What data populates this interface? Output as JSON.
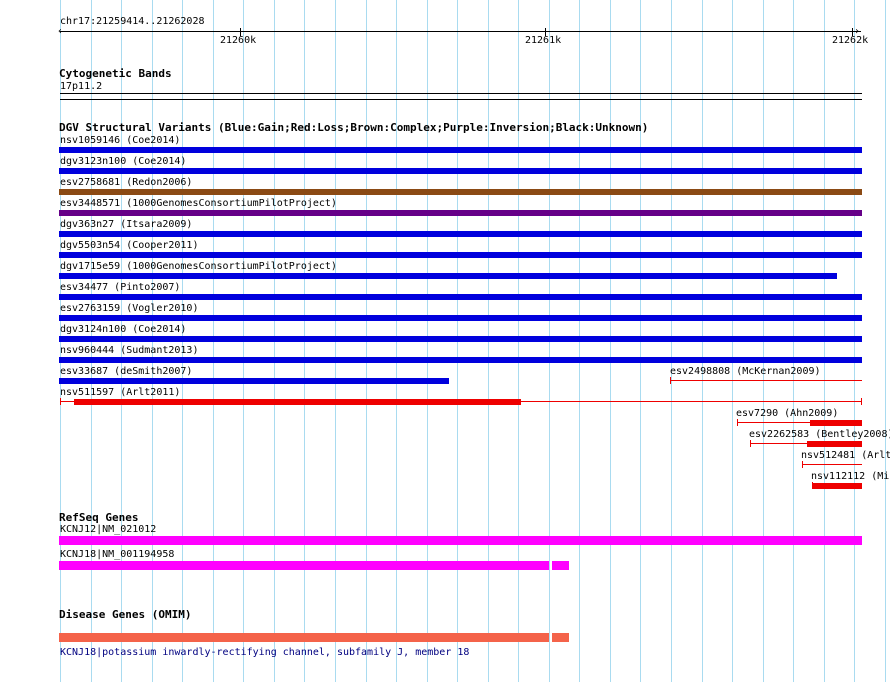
{
  "ruler": {
    "location": "chr17:21259414..21262028",
    "ticks": [
      "21260k",
      "21261k",
      "21262k"
    ]
  },
  "cytoband": {
    "title": "Cytogenetic Bands",
    "band": "17p11.2"
  },
  "dgv": {
    "title": "DGV Structural Variants (Blue:Gain;Red:Loss;Brown:Complex;Purple:Inversion;Black:Unknown)",
    "colors": {
      "gain": "#0000dd",
      "loss": "#ee0000",
      "complex": "#8b4a14",
      "inversion": "#660088"
    },
    "features": [
      {
        "label": "nsv1059146 (Coe2014)",
        "type": "gain"
      },
      {
        "label": "dgv3123n100 (Coe2014)",
        "type": "gain"
      },
      {
        "label": "esv2758681 (Redon2006)",
        "type": "complex"
      },
      {
        "label": "esv3448571 (1000GenomesConsortiumPilotProject)",
        "type": "inversion"
      },
      {
        "label": "dgv363n27 (Itsara2009)",
        "type": "gain"
      },
      {
        "label": "dgv5503n54 (Cooper2011)",
        "type": "gain"
      },
      {
        "label": "dgv1715e59 (1000GenomesConsortiumPilotProject)",
        "type": "gain"
      },
      {
        "label": "esv34477 (Pinto2007)",
        "type": "gain"
      },
      {
        "label": "esv2763159 (Vogler2010)",
        "type": "gain"
      },
      {
        "label": "dgv3124n100 (Coe2014)",
        "type": "gain"
      },
      {
        "label": "nsv960444 (Sudmant2013)",
        "type": "gain"
      },
      {
        "label": "esv33687 (deSmith2007)",
        "type": "gain"
      },
      {
        "label": "esv2498808 (McKernan2009)",
        "type": "loss"
      },
      {
        "label": "nsv511597 (Arlt2011)",
        "type": "loss"
      },
      {
        "label": "esv7290 (Ahn2009)",
        "type": "loss"
      },
      {
        "label": "esv2262583 (Bentley2008)",
        "type": "loss"
      },
      {
        "label": "nsv512481 (Arlt",
        "type": "loss"
      },
      {
        "label": "nsv112112 (Mi",
        "type": "loss"
      }
    ]
  },
  "refseq": {
    "title": "RefSeq Genes",
    "color": "#ff00ff",
    "genes": [
      "KCNJ12|NM_021012",
      "KCNJ18|NM_001194958"
    ]
  },
  "omim": {
    "title": "Disease Genes (OMIM)",
    "color": "#f4634a",
    "gene_label": "KCNJ18|potassium inwardly-rectifying channel, subfamily J, member 18"
  }
}
